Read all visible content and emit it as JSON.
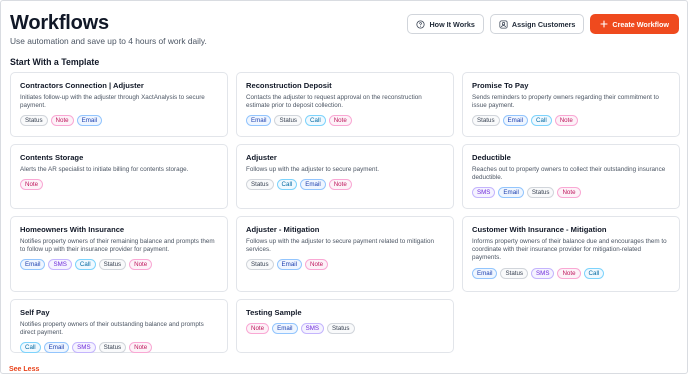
{
  "header": {
    "title": "Workflows",
    "subtitle": "Use automation and save up to 4 hours of work daily.",
    "buttons": {
      "how_it_works": "How It Works",
      "assign_customers": "Assign Customers",
      "create_workflow": "Create Workflow"
    },
    "icons": {
      "how_it_works": "question-circle-icon",
      "assign_customers": "user-icon",
      "create_workflow": "plus-icon"
    }
  },
  "section_title": "Start With a Template",
  "tag_styles": {
    "Status": {
      "color": "#374151",
      "border": "#d1d5db",
      "bg": "#f9fafb"
    },
    "Note": {
      "color": "#be185d",
      "border": "#f9a8d4",
      "bg": "#fdf2f8"
    },
    "Email": {
      "color": "#1e40af",
      "border": "#93c5fd",
      "bg": "#eff6ff"
    },
    "Call": {
      "color": "#0369a1",
      "border": "#7dd3fc",
      "bg": "#f0f9ff"
    },
    "SMS": {
      "color": "#6d28d9",
      "border": "#c4b5fd",
      "bg": "#f5f3ff"
    }
  },
  "templates": [
    {
      "title": "Contractors Connection | Adjuster",
      "description": "Initiates follow-up with the adjuster through XactAnalysis to secure payment.",
      "tags": [
        "Status",
        "Note",
        "Email"
      ]
    },
    {
      "title": "Reconstruction Deposit",
      "description": "Contacts the adjuster to request approval on the reconstruction estimate prior to deposit collection.",
      "tags": [
        "Email",
        "Status",
        "Call",
        "Note"
      ]
    },
    {
      "title": "Promise To Pay",
      "description": "Sends reminders to property owners regarding their commitment to issue payment.",
      "tags": [
        "Status",
        "Email",
        "Call",
        "Note"
      ]
    },
    {
      "title": "Contents Storage",
      "description": "Alerts the AR specialist to initiate billing for contents storage.",
      "tags": [
        "Note"
      ]
    },
    {
      "title": "Adjuster",
      "description": "Follows up with the adjuster to secure payment.",
      "tags": [
        "Status",
        "Call",
        "Email",
        "Note"
      ]
    },
    {
      "title": "Deductible",
      "description": "Reaches out to property owners to collect their outstanding insurance deductible.",
      "tags": [
        "SMS",
        "Email",
        "Status",
        "Note"
      ]
    },
    {
      "title": "Homeowners With Insurance",
      "description": "Notifies property owners of their remaining balance and prompts them to follow up with their insurance provider for payment.",
      "tags": [
        "Email",
        "SMS",
        "Call",
        "Status",
        "Note"
      ]
    },
    {
      "title": "Adjuster - Mitigation",
      "description": "Follows up with the adjuster to secure payment related to mitigation services.",
      "tags": [
        "Status",
        "Email",
        "Note"
      ]
    },
    {
      "title": "Customer With Insurance - Mitigation",
      "description": "Informs property owners of their balance due and encourages them to coordinate with their insurance provider for mitigation-related payments.",
      "tags": [
        "Email",
        "Status",
        "SMS",
        "Note",
        "Call"
      ]
    },
    {
      "title": "Self Pay",
      "description": "Notifies property owners of their outstanding balance and prompts direct payment.",
      "tags": [
        "Call",
        "Email",
        "SMS",
        "Status",
        "Note"
      ]
    },
    {
      "title": "Testing Sample",
      "description": "",
      "tags": [
        "Note",
        "Email",
        "SMS",
        "Status"
      ]
    }
  ],
  "see_less": "See Less"
}
